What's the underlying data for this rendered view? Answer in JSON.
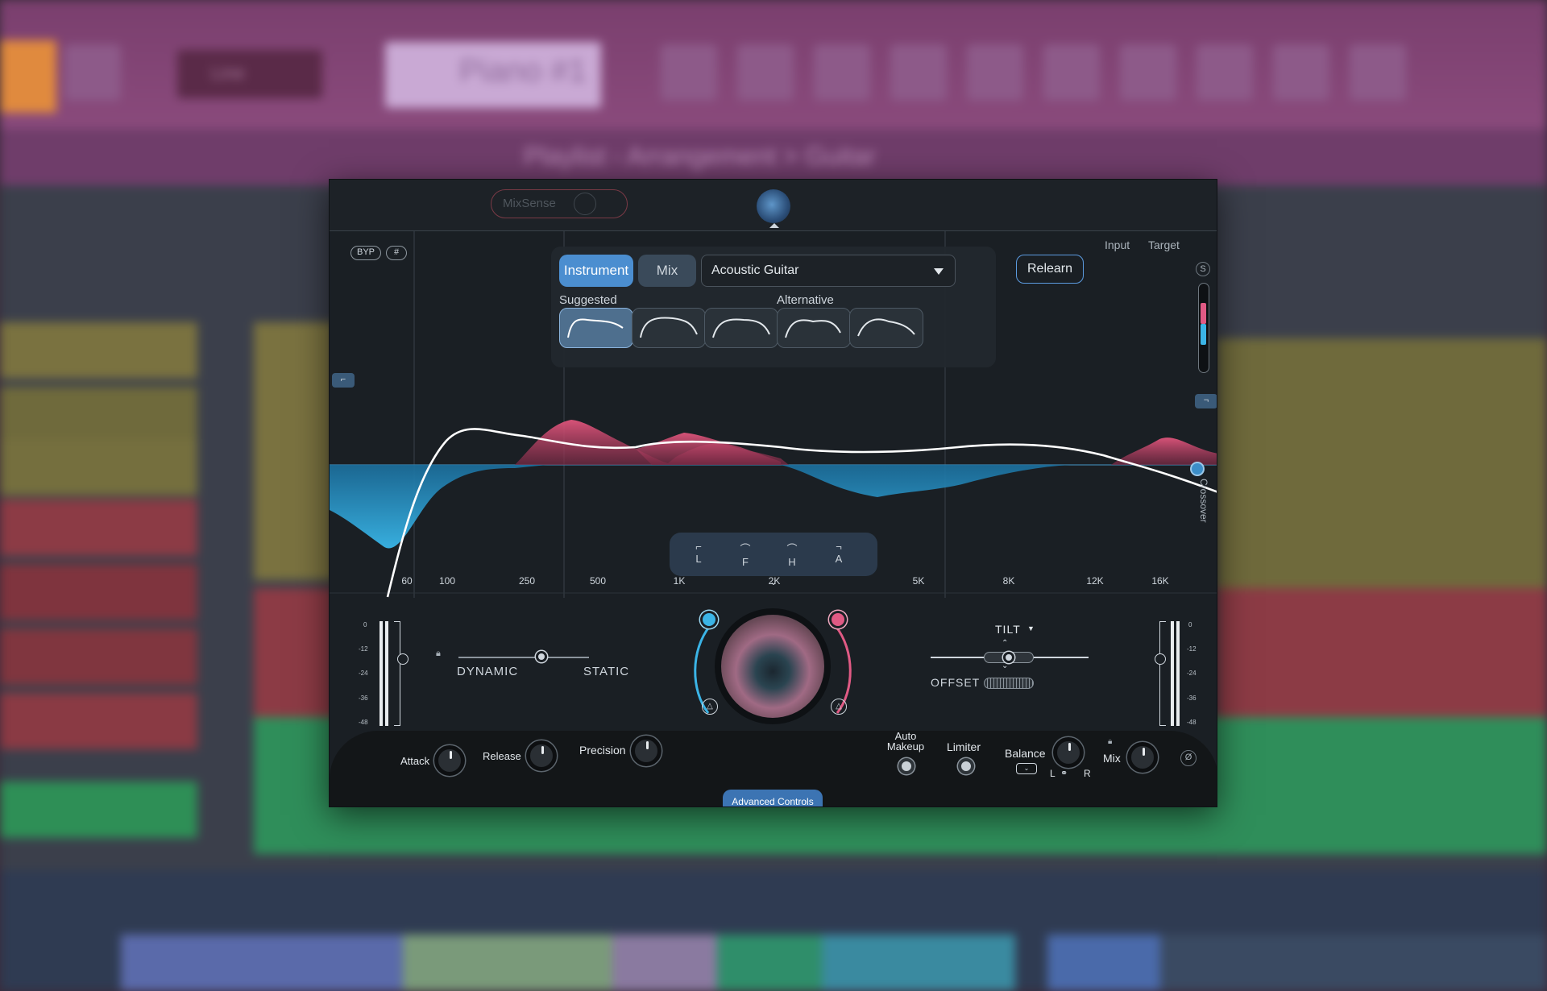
{
  "background": {
    "daw_toolbar_hint": "Playlist - Arrangement > Guitar",
    "track_name": "Piano #1",
    "mode": "Line"
  },
  "plugin": {
    "top": {
      "mixsense_label": "MixSense"
    },
    "eq": {
      "byp_label": "BYP",
      "grid_label": "#",
      "input_label": "Input",
      "target_label": "Target",
      "solo_label": "S",
      "crossover_label": "Crossover",
      "frequencies": [
        "60",
        "100",
        "250",
        "500",
        "1K",
        "2K",
        "5K",
        "8K",
        "12K",
        "16K"
      ],
      "band_buttons": [
        "L",
        "F",
        "H",
        "A"
      ]
    },
    "target_panel": {
      "tabs": [
        {
          "label": "Instrument",
          "selected": true
        },
        {
          "label": "Mix",
          "selected": false
        }
      ],
      "dropdown_value": "Acoustic Guitar",
      "suggested_label": "Suggested",
      "alternative_label": "Alternative",
      "relearn_label": "Relearn"
    },
    "controls": {
      "meter_scale": [
        "0",
        "-12",
        "-24",
        "-36",
        "-48"
      ],
      "dynamic_label": "DYNAMIC",
      "static_label": "STATIC",
      "tilt_label": "TILT",
      "offset_label": "OFFSET",
      "attack_label": "Attack",
      "release_label": "Release",
      "precision_label": "Precision",
      "advanced_label": "Advanced Controls",
      "auto_makeup_label": "Auto Makeup",
      "limiter_label": "Limiter",
      "balance_label": "Balance",
      "balance_l": "L",
      "balance_r": "R",
      "mix_label": "Mix",
      "phase_label": "Ø"
    }
  }
}
